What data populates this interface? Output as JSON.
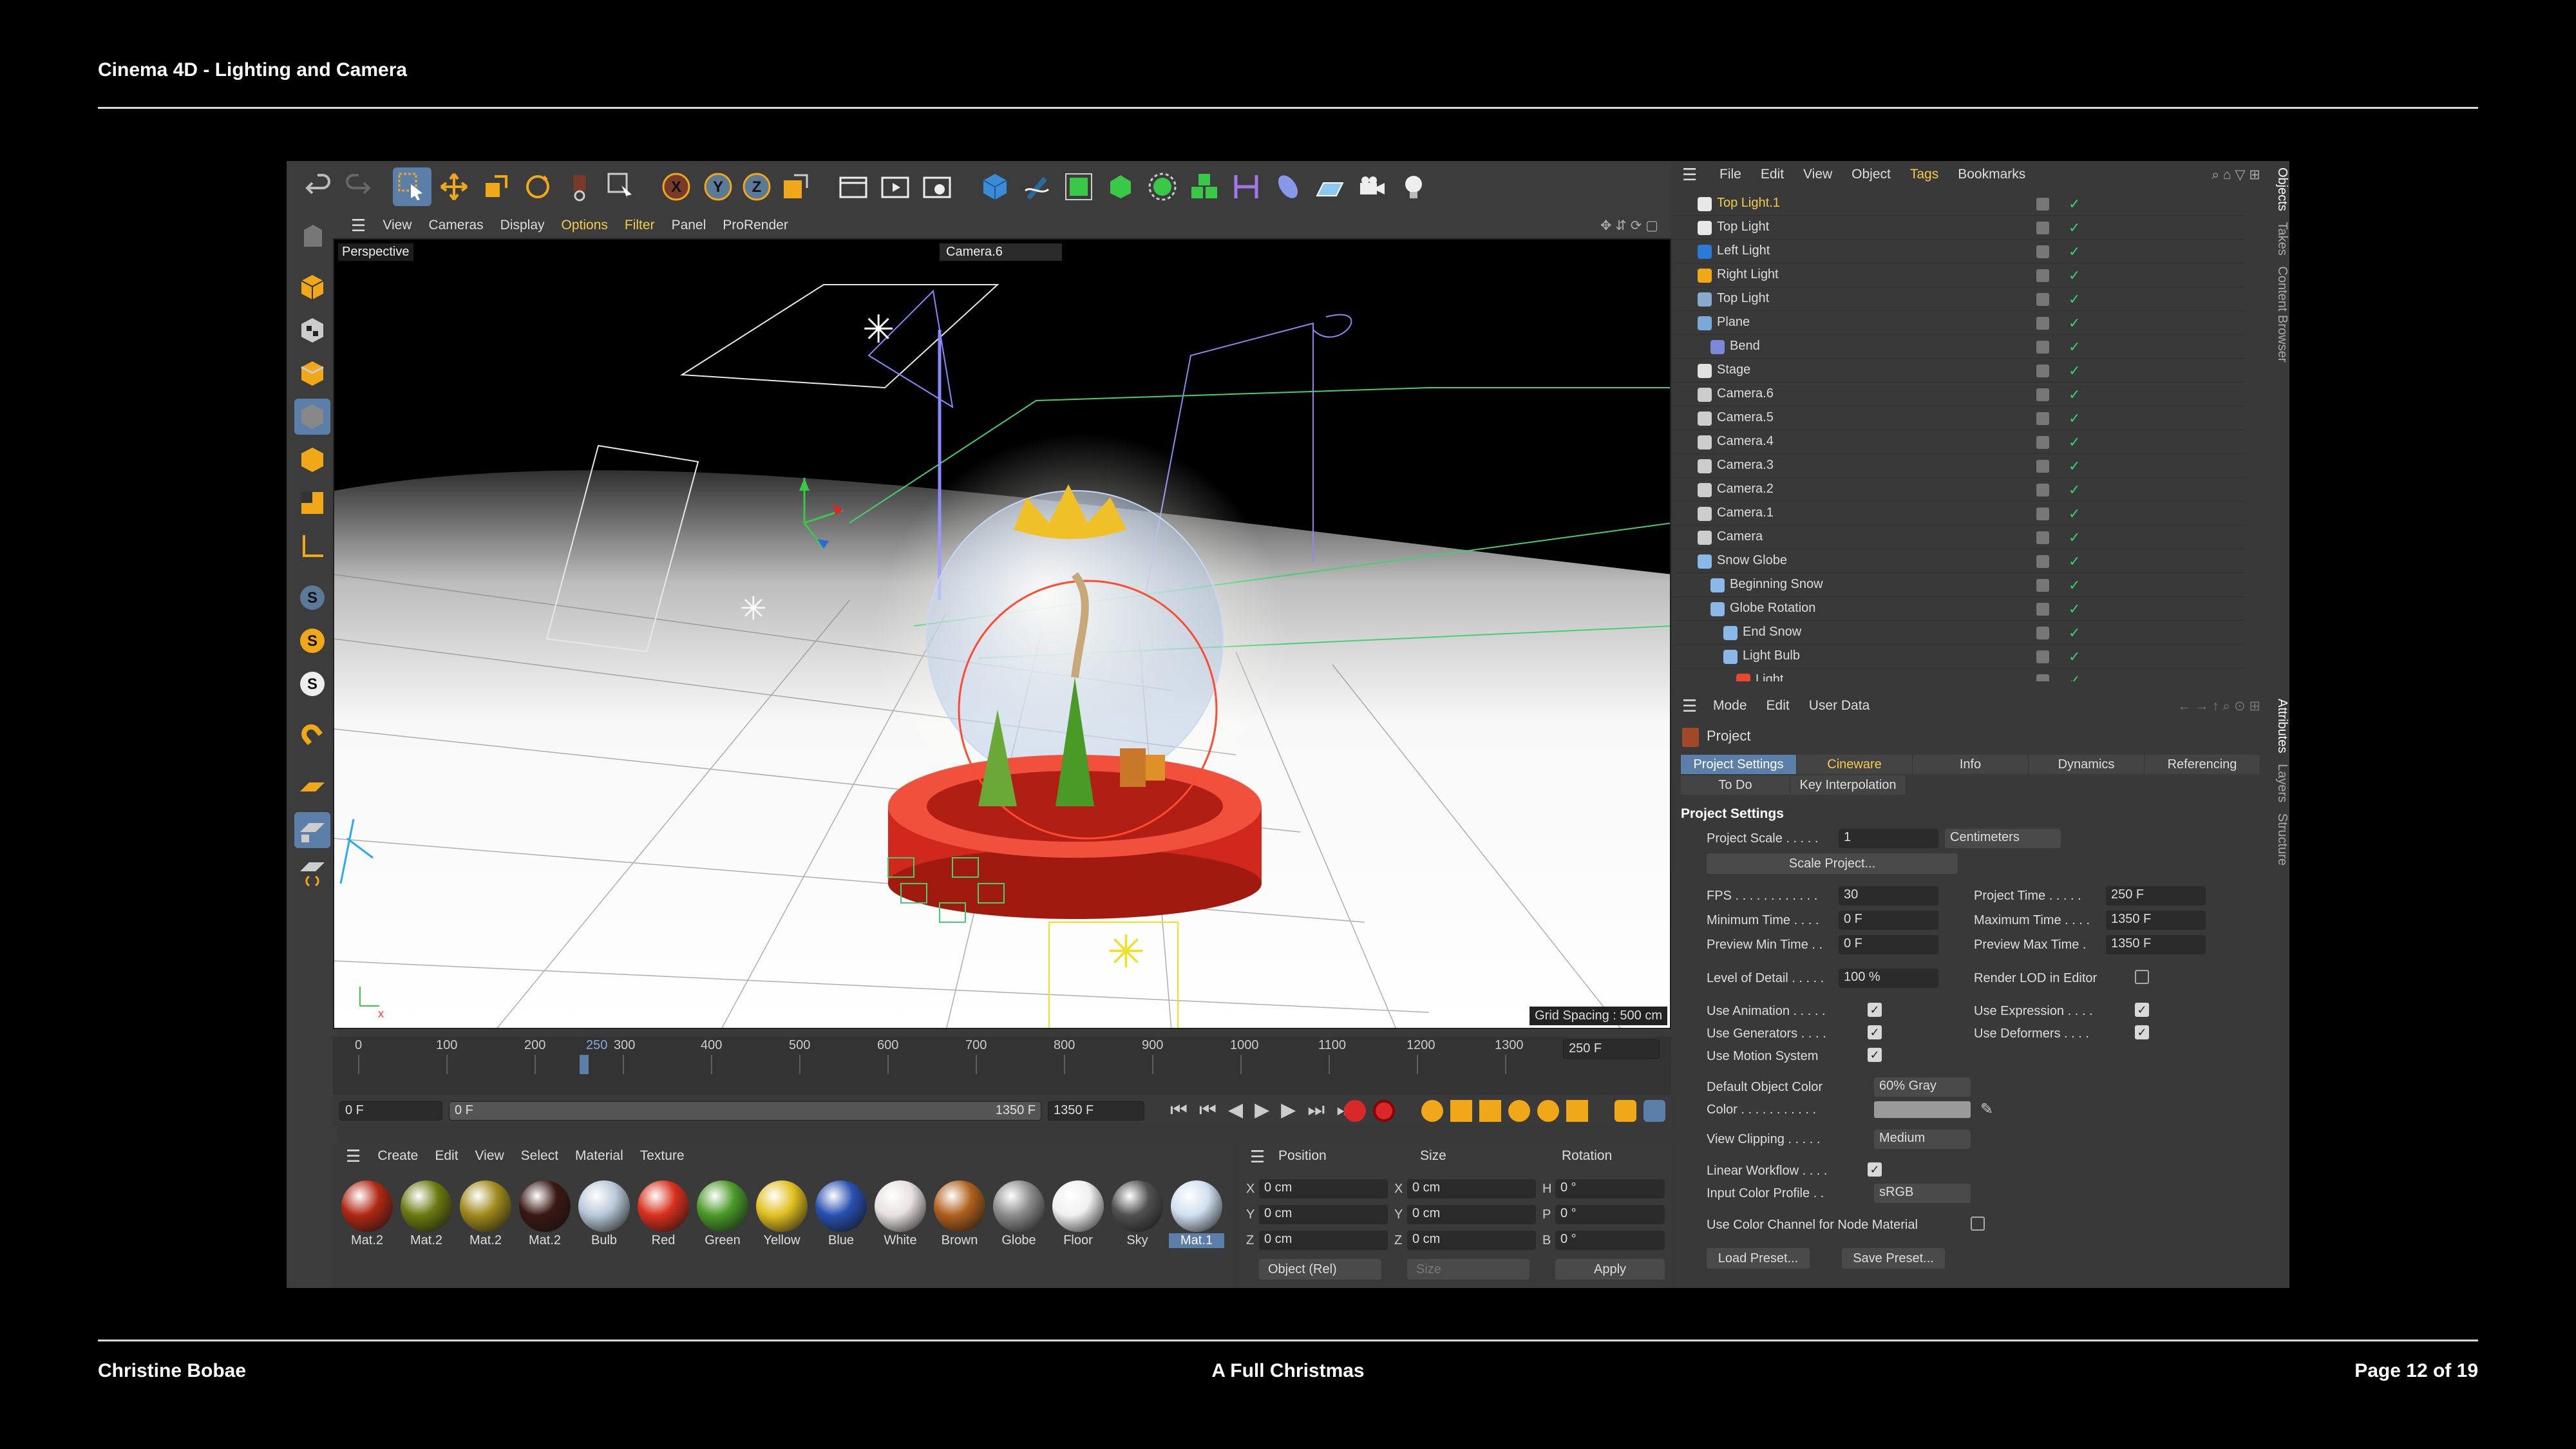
{
  "slide": {
    "title": "Cinema 4D - Lighting and Camera",
    "author": "Christine Bobae",
    "subtitle": "A Full Christmas",
    "page": "Page 12 of 19"
  },
  "viewport": {
    "menu": [
      "View",
      "Cameras",
      "Display",
      "Options",
      "Filter",
      "Panel",
      "ProRender"
    ],
    "view_label": "Perspective",
    "camera_label": "Camera.6",
    "grid_spacing": "Grid Spacing : 500 cm"
  },
  "timeline": {
    "ticks": [
      "0",
      "100",
      "200",
      "250",
      "300",
      "400",
      "500",
      "600",
      "700",
      "800",
      "900",
      "1000",
      "1100",
      "1200",
      "1300"
    ],
    "end_frame": "250 F",
    "current": "0 F",
    "preview_start": "0 F",
    "preview_end": "1350 F",
    "max": "1350 F"
  },
  "materials": {
    "menu": [
      "Create",
      "Edit",
      "View",
      "Select",
      "Material",
      "Texture"
    ],
    "items": [
      {
        "name": "Mat.2",
        "color": "#b02814"
      },
      {
        "name": "Mat.2",
        "color": "#6c7a10"
      },
      {
        "name": "Mat.2",
        "color": "#a08a1c"
      },
      {
        "name": "Mat.2",
        "color": "#3a1814"
      },
      {
        "name": "Bulb",
        "color": "#b8c8d8"
      },
      {
        "name": "Red",
        "color": "#d8301c"
      },
      {
        "name": "Green",
        "color": "#4a9a28"
      },
      {
        "name": "Yellow",
        "color": "#e0c020"
      },
      {
        "name": "Blue",
        "color": "#2850b0"
      },
      {
        "name": "White",
        "color": "#e8e0e0"
      },
      {
        "name": "Brown",
        "color": "#b0601c"
      },
      {
        "name": "Globe",
        "color": "#8c8c8c"
      },
      {
        "name": "Floor",
        "color": "#f0f0f0"
      },
      {
        "name": "Sky",
        "color": "#505050"
      },
      {
        "name": "Mat.1",
        "color": "#d0e0f0"
      }
    ]
  },
  "coordinates": {
    "headers": [
      "Position",
      "Size",
      "Rotation"
    ],
    "rows": [
      {
        "axis": "X",
        "pos": "0 cm",
        "size_axis": "X",
        "size": "0 cm",
        "rot_axis": "H",
        "rot": "0 °"
      },
      {
        "axis": "Y",
        "pos": "0 cm",
        "size_axis": "Y",
        "size": "0 cm",
        "rot_axis": "P",
        "rot": "0 °"
      },
      {
        "axis": "Z",
        "pos": "0 cm",
        "size_axis": "Z",
        "size": "0 cm",
        "rot_axis": "B",
        "rot": "0 °"
      }
    ],
    "mode": "Object (Rel)",
    "size_mode": "Size",
    "apply": "Apply"
  },
  "objects": {
    "menu": [
      "File",
      "Edit",
      "View",
      "Object",
      "Tags",
      "Bookmarks"
    ],
    "rows": [
      {
        "name": "Top Light.1",
        "indent": 0,
        "highlight": true,
        "icon_color": "#e8e8e8"
      },
      {
        "name": "Top Light",
        "indent": 0,
        "highlight": false,
        "icon_color": "#e8e8e8"
      },
      {
        "name": "Left Light",
        "indent": 0,
        "highlight": false,
        "icon_color": "#2a7ad8"
      },
      {
        "name": "Right Light",
        "indent": 0,
        "highlight": false,
        "icon_color": "#f0a818"
      },
      {
        "name": "Top Light",
        "indent": 0,
        "highlight": false,
        "icon_color": "#88aacc"
      },
      {
        "name": "Plane",
        "indent": 0,
        "highlight": false,
        "icon_color": "#7aa8d8"
      },
      {
        "name": "Bend",
        "indent": 1,
        "highlight": false,
        "icon_color": "#7a8ad8"
      },
      {
        "name": "Stage",
        "indent": 0,
        "highlight": false,
        "icon_color": "#e0e0e0"
      },
      {
        "name": "Camera.6",
        "indent": 0,
        "highlight": false,
        "icon_color": "#cccccc"
      },
      {
        "name": "Camera.5",
        "indent": 0,
        "highlight": false,
        "icon_color": "#cccccc"
      },
      {
        "name": "Camera.4",
        "indent": 0,
        "highlight": false,
        "icon_color": "#cccccc"
      },
      {
        "name": "Camera.3",
        "indent": 0,
        "highlight": false,
        "icon_color": "#cccccc"
      },
      {
        "name": "Camera.2",
        "indent": 0,
        "highlight": false,
        "icon_color": "#cccccc"
      },
      {
        "name": "Camera.1",
        "indent": 0,
        "highlight": false,
        "icon_color": "#cccccc"
      },
      {
        "name": "Camera",
        "indent": 0,
        "highlight": false,
        "icon_color": "#cccccc"
      },
      {
        "name": "Snow Globe",
        "indent": 0,
        "highlight": false,
        "icon_color": "#8ab8e8"
      },
      {
        "name": "Beginning Snow",
        "indent": 1,
        "highlight": false,
        "icon_color": "#8ab8e8"
      },
      {
        "name": "Globe Rotation",
        "indent": 1,
        "highlight": false,
        "icon_color": "#8ab8e8"
      },
      {
        "name": "End Snow",
        "indent": 2,
        "highlight": false,
        "icon_color": "#8ab8e8"
      },
      {
        "name": "Light Bulb",
        "indent": 2,
        "highlight": false,
        "icon_color": "#8ab8e8"
      },
      {
        "name": "Light",
        "indent": 3,
        "highlight": false,
        "icon_color": "#e84830"
      }
    ],
    "side_tabs": [
      "Objects",
      "Takes",
      "Content Browser"
    ]
  },
  "attributes": {
    "menu": [
      "Mode",
      "Edit",
      "User Data"
    ],
    "title": "Project",
    "tabs_row1": [
      "Project Settings",
      "Cineware",
      "Info",
      "Dynamics",
      "Referencing"
    ],
    "tabs_row2": [
      "To Do",
      "Key Interpolation"
    ],
    "section": "Project Settings",
    "project_scale_label": "Project Scale . . . . .",
    "project_scale": "1",
    "units": "Centimeters",
    "scale_button": "Scale Project...",
    "fps_label": "FPS . . . . . . . . . . . .",
    "fps": "30",
    "project_time_label": "Project Time . . . . .",
    "project_time": "250 F",
    "min_time_label": "Minimum Time . . . .",
    "min_time": "0 F",
    "max_time_label": "Maximum Time . . . .",
    "max_time": "1350 F",
    "prev_min_label": "Preview Min Time . .",
    "prev_min": "0 F",
    "prev_max_label": "Preview Max Time .",
    "prev_max": "1350 F",
    "lod_label": "Level of Detail . . . . .",
    "lod": "100 %",
    "render_lod_label": "Render LOD in Editor",
    "use_animation": "Use Animation . . . . .",
    "use_expression": "Use Expression . . . .",
    "use_generators": "Use Generators . . . .",
    "use_deformers": "Use Deformers . . . .",
    "use_motion": "Use Motion System",
    "default_color_label": "Default Object Color",
    "default_color": "60% Gray",
    "color_label": "Color . . . . . . . . . . .",
    "view_clipping_label": "View Clipping . . . . .",
    "view_clipping": "Medium",
    "linear_label": "Linear Workflow . . . .",
    "input_profile_label": "Input Color Profile . .",
    "input_profile": "sRGB",
    "node_material_label": "Use Color Channel for Node Material",
    "load_preset": "Load Preset...",
    "save_preset": "Save Preset...",
    "side_tabs": [
      "Attributes",
      "Layers",
      "Structure"
    ]
  }
}
